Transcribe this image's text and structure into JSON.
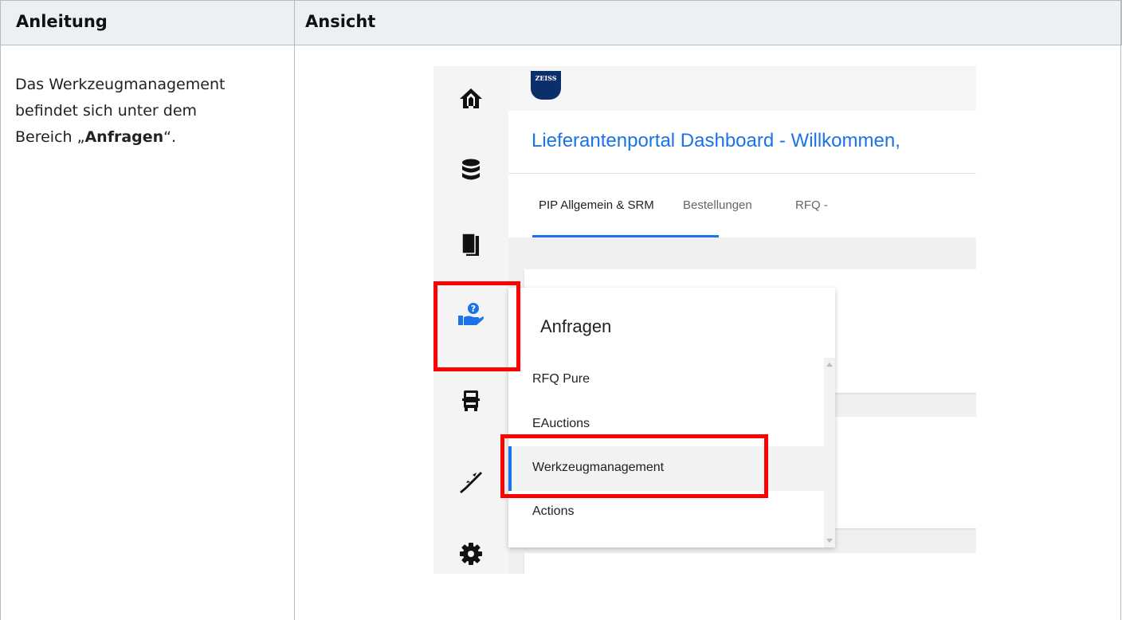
{
  "table": {
    "header_left": "Anleitung",
    "header_right": "Ansicht",
    "instruction": {
      "prefix": "Das Werkzeugmanagement befindet sich unter dem Bereich „",
      "bold": "Anfragen",
      "suffix": "“."
    }
  },
  "screenshot": {
    "logo_text": "ZEISS",
    "dashboard_title": "Lieferantenportal Dashboard - Willkommen,",
    "tabs": [
      "PIP Allgemein & SRM",
      "Bestellungen",
      "RFQ -"
    ],
    "active_tab": "PIP Allgemein & SRM",
    "sidebar_icons": [
      "home-icon",
      "database-icon",
      "documents-icon",
      "hand-question-icon",
      "truck-icon",
      "caliper-icon",
      "gear-icon"
    ],
    "flyout": {
      "title": "Anfragen",
      "items": [
        "RFQ Pure",
        "EAuctions",
        "Werkzeugmanagement",
        "Actions"
      ],
      "active_item": "Werkzeugmanagement"
    },
    "highlight_color": "#ff0000",
    "accent_color": "#1a73e8"
  }
}
